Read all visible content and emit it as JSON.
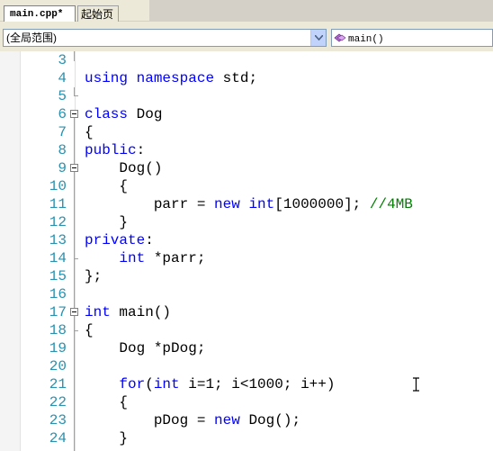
{
  "tabs": [
    {
      "label": "main.cpp*",
      "active": true
    },
    {
      "label": "起始页",
      "active": false
    }
  ],
  "navbar": {
    "scope_value": "(全局范围)",
    "member_value": "main()",
    "member_icon": "function-icon"
  },
  "code_lines": [
    {
      "number": "3",
      "text": ""
    },
    {
      "number": "4",
      "text": "using namespace std;"
    },
    {
      "number": "5",
      "text": ""
    },
    {
      "number": "6",
      "text": "class Dog"
    },
    {
      "number": "7",
      "text": "{"
    },
    {
      "number": "8",
      "text": "public:"
    },
    {
      "number": "9",
      "text": "    Dog()"
    },
    {
      "number": "10",
      "text": "    {"
    },
    {
      "number": "11",
      "text": "        parr = new int[1000000]; //4MB"
    },
    {
      "number": "12",
      "text": "    }"
    },
    {
      "number": "13",
      "text": "private:"
    },
    {
      "number": "14",
      "text": "    int *parr;"
    },
    {
      "number": "15",
      "text": "};"
    },
    {
      "number": "16",
      "text": ""
    },
    {
      "number": "17",
      "text": "int main()"
    },
    {
      "number": "18",
      "text": "{"
    },
    {
      "number": "19",
      "text": "    Dog *pDog;"
    },
    {
      "number": "20",
      "text": ""
    },
    {
      "number": "21",
      "text": "    for(int i=1; i<1000; i++)"
    },
    {
      "number": "22",
      "text": "    {"
    },
    {
      "number": "23",
      "text": "        pDog = new Dog();"
    },
    {
      "number": "24",
      "text": "    }"
    }
  ],
  "colors": {
    "keyword": "#0000ff",
    "comment": "#008000",
    "line_number": "#2b91af",
    "text": "#000000"
  }
}
